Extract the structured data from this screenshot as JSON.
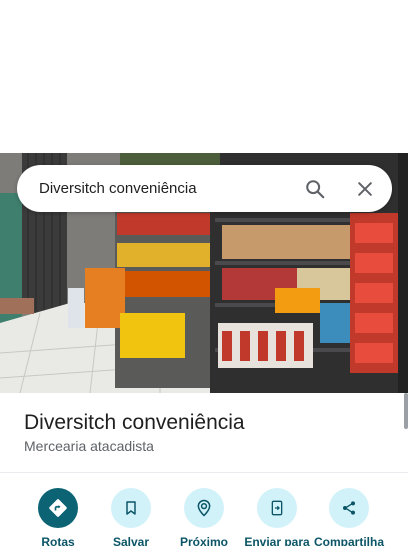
{
  "search": {
    "query": "Diversitch conveniência"
  },
  "icons": {
    "search": "search-icon",
    "close": "close-icon"
  },
  "place": {
    "name": "Diversitch conveniência",
    "category": "Mercearia atacadista"
  },
  "actions": [
    {
      "label": "Rotas",
      "icon": "directions-icon"
    },
    {
      "label": "Salvar",
      "icon": "bookmark-icon"
    },
    {
      "label": "Próximo",
      "icon": "nearby-icon"
    },
    {
      "label": "Enviar para",
      "icon": "send-to-phone-icon"
    },
    {
      "label": "Compartilha",
      "icon": "share-icon"
    }
  ],
  "colors": {
    "accent": "#0b6374",
    "action_bg": "#d2f2fa",
    "label": "#0b5566"
  }
}
